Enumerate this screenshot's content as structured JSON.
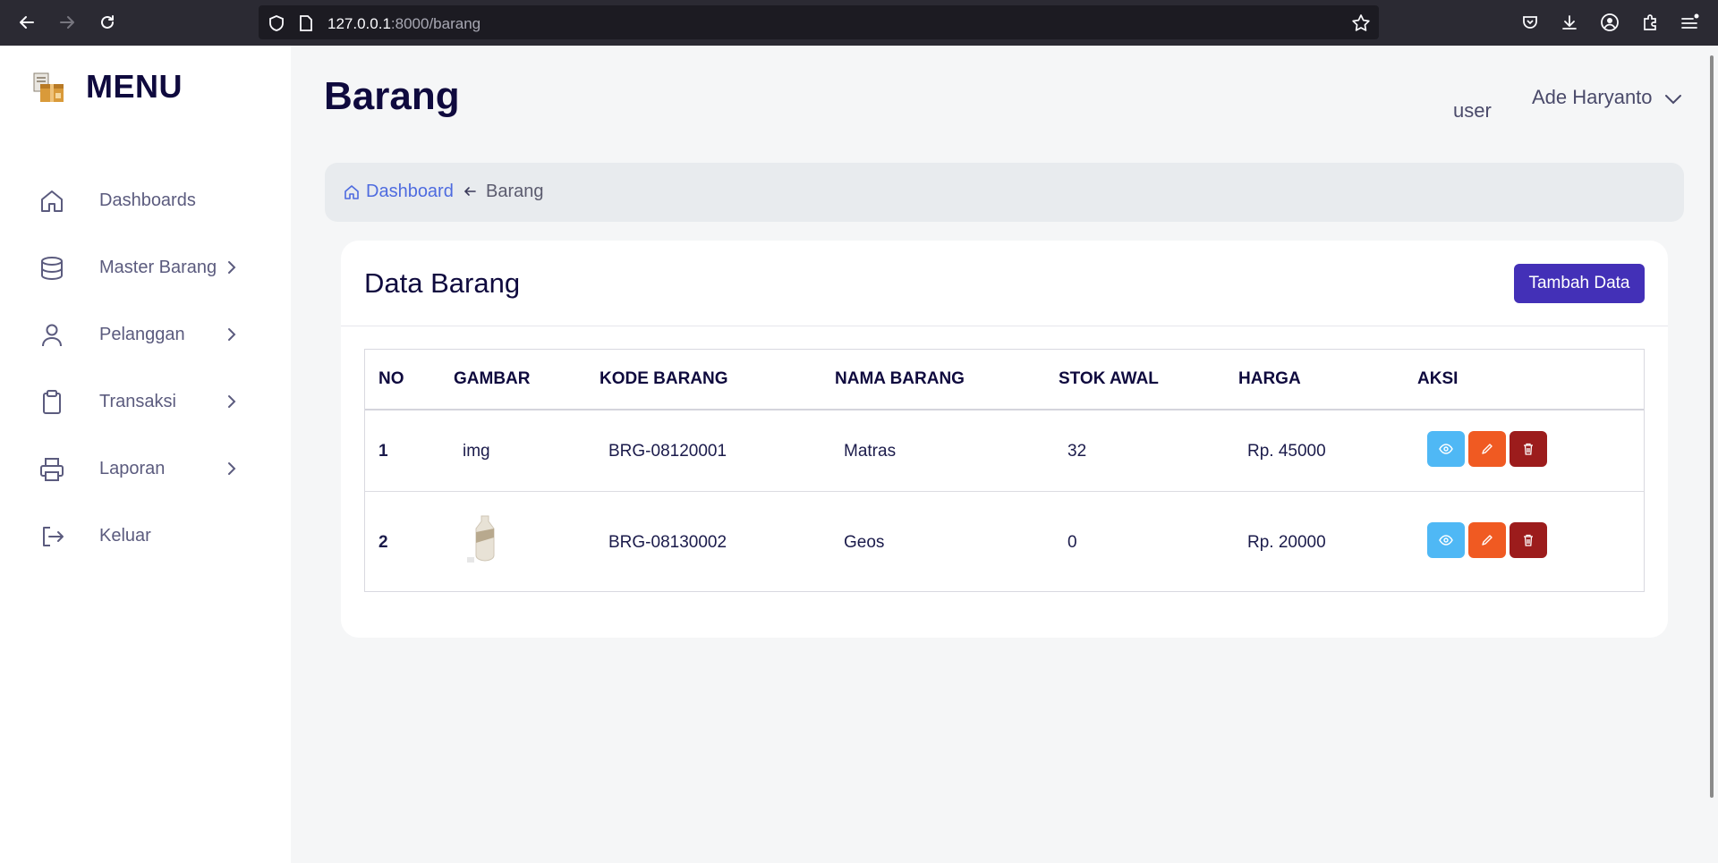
{
  "browser": {
    "url_host": "127.0.0.1",
    "url_path": ":8000/barang"
  },
  "sidebar": {
    "title": "MENU",
    "items": [
      {
        "label": "Dashboards",
        "icon": "home-icon",
        "has_submenu": false
      },
      {
        "label": "Master Barang",
        "icon": "database-icon",
        "has_submenu": true
      },
      {
        "label": "Pelanggan",
        "icon": "user-icon",
        "has_submenu": true
      },
      {
        "label": "Transaksi",
        "icon": "clipboard-icon",
        "has_submenu": true
      },
      {
        "label": "Laporan",
        "icon": "printer-icon",
        "has_submenu": true
      },
      {
        "label": "Keluar",
        "icon": "logout-icon",
        "has_submenu": false
      }
    ]
  },
  "header": {
    "title": "Barang",
    "role": "user",
    "user_name": "Ade Haryanto"
  },
  "breadcrumb": {
    "home": "Dashboard",
    "current": "Barang"
  },
  "card": {
    "title": "Data Barang",
    "add_button": "Tambah Data"
  },
  "table": {
    "columns": [
      "NO",
      "GAMBAR",
      "KODE BARANG",
      "NAMA BARANG",
      "STOK AWAL",
      "HARGA",
      "AKSI"
    ],
    "rows": [
      {
        "no": "1",
        "gambar": "img",
        "kode": "BRG-08120001",
        "nama": "Matras",
        "stok": "32",
        "harga": "Rp. 45000"
      },
      {
        "no": "2",
        "gambar": "",
        "kode": "BRG-08130002",
        "nama": "Geos",
        "stok": "0",
        "harga": "Rp. 20000"
      }
    ]
  },
  "colors": {
    "brand": "#4330b7",
    "view": "#4fb8f5",
    "edit": "#f05a22",
    "delete": "#9c1c1c",
    "link": "#4e6bdf"
  }
}
